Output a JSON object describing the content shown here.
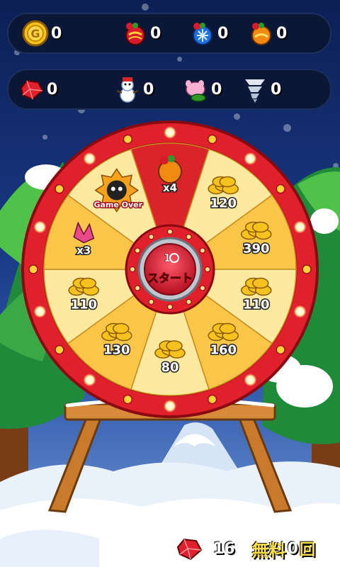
{
  "hud": {
    "row1": [
      {
        "icon": "gold-coin-icon",
        "count": "0"
      },
      {
        "icon": "red-ornament-icon",
        "count": "0"
      },
      {
        "icon": "blue-ornament-icon",
        "count": "0"
      },
      {
        "icon": "orange-ornament-icon",
        "count": "0"
      }
    ],
    "row2": [
      {
        "icon": "red-gem-icon",
        "count": "0"
      },
      {
        "icon": "snowman-icon",
        "count": "0"
      },
      {
        "icon": "pink-pig-icon",
        "count": "0"
      },
      {
        "icon": "tornado-icon",
        "count": "0"
      }
    ]
  },
  "wheel": {
    "center_label": "スタート",
    "center_number": "1",
    "segments": [
      {
        "label": "",
        "type": "ornament",
        "multiplier": "x4",
        "color": "#d9242a"
      },
      {
        "label": "120",
        "type": "coins",
        "color": "#fde9a0"
      },
      {
        "label": "390",
        "type": "coins",
        "color": "#f9c64a"
      },
      {
        "label": "110",
        "type": "coins",
        "color": "#fde9a0"
      },
      {
        "label": "160",
        "type": "coins",
        "color": "#f9c64a"
      },
      {
        "label": "80",
        "type": "coins",
        "color": "#fde9a0"
      },
      {
        "label": "130",
        "type": "coins",
        "color": "#f9c64a"
      },
      {
        "label": "110",
        "type": "coins",
        "color": "#fde9a0"
      },
      {
        "label": "",
        "type": "gems",
        "multiplier": "x3",
        "color": "#f9c64a"
      },
      {
        "label": "Game Over",
        "type": "bomb",
        "color": "#fde9a0"
      }
    ]
  },
  "footer": {
    "gem_icon": "red-gem-icon",
    "gem_count": "16",
    "free_label": "無料",
    "free_count": "0",
    "free_unit": "回"
  },
  "colors": {
    "sky_top": "#0c1f55",
    "rim_red": "#e0202a",
    "stand_wood": "#c97a2a",
    "snow": "#ffffff"
  }
}
